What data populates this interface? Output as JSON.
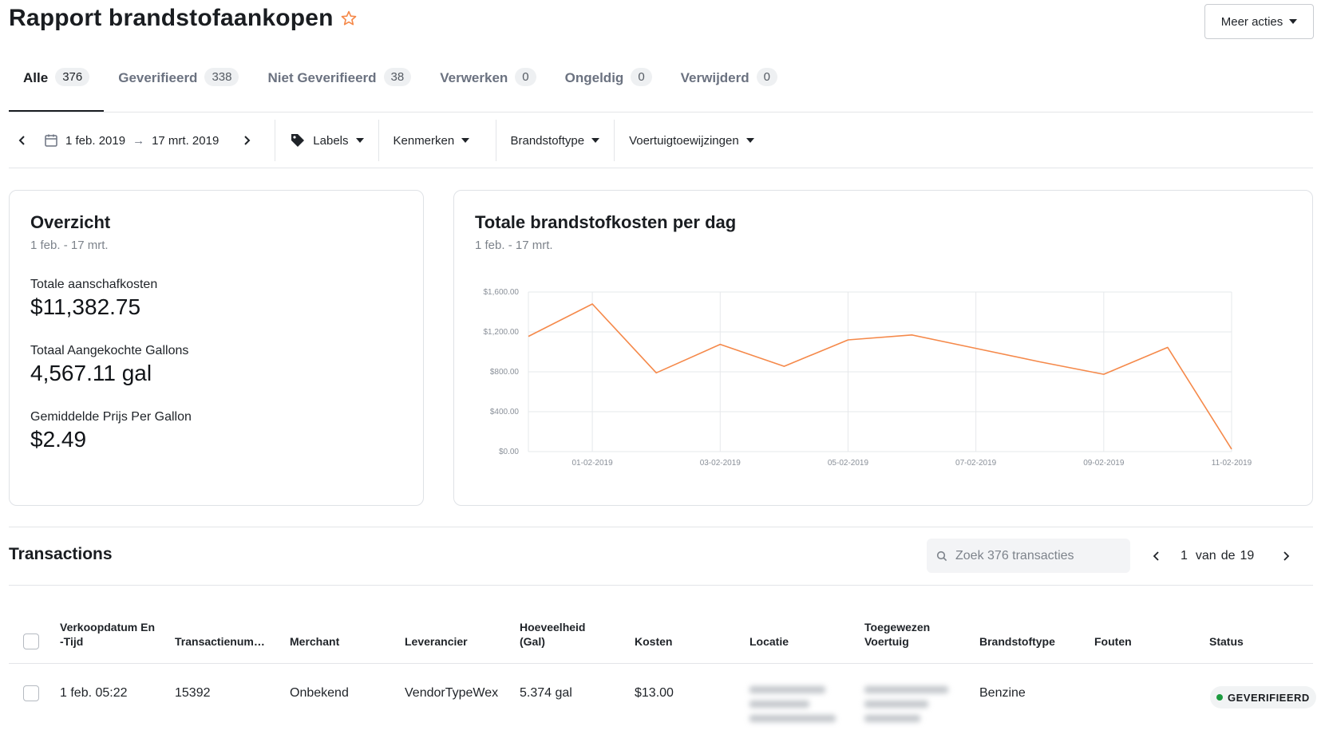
{
  "header": {
    "title": "Rapport brandstofaankopen",
    "more_actions_label": "Meer acties"
  },
  "tabs": [
    {
      "label": "Alle",
      "count": "376",
      "active": true
    },
    {
      "label": "Geverifieerd",
      "count": "338"
    },
    {
      "label": "Niet Geverifieerd",
      "count": "38"
    },
    {
      "label": "Verwerken",
      "count": "0"
    },
    {
      "label": "Ongeldig",
      "count": "0"
    },
    {
      "label": "Verwijderd",
      "count": "0"
    }
  ],
  "filters": {
    "date_from": "1 feb. 2019",
    "date_arrow": "→",
    "date_to": "17 mrt. 2019",
    "labels": "Labels",
    "features": "Kenmerken",
    "fuel_type": "Brandstoftype",
    "vehicle_assignments": "Voertuigtoewijzingen"
  },
  "overview": {
    "title": "Overzicht",
    "subtitle": "1 feb. - 17 mrt.",
    "metrics": [
      {
        "label": "Totale aanschafkosten",
        "value": "$11,382.75"
      },
      {
        "label": "Totaal Aangekochte Gallons",
        "value": "4,567.11 gal"
      },
      {
        "label": "Gemiddelde Prijs Per Gallon",
        "value": "$2.49"
      }
    ]
  },
  "chart_card": {
    "title": "Totale brandstofkosten per dag",
    "subtitle": "1 feb. - 17 mrt."
  },
  "chart_data": {
    "type": "line",
    "title": "Totale brandstofkosten per dag",
    "x": [
      "31-01-2019",
      "01-02-2019",
      "02-02-2019",
      "03-02-2019",
      "04-02-2019",
      "05-02-2019",
      "06-02-2019",
      "07-02-2019",
      "08-02-2019",
      "09-02-2019",
      "10-02-2019",
      "11-02-2019"
    ],
    "series": [
      {
        "values": [
          1155,
          1480,
          790,
          1075,
          855,
          1120,
          1170,
          1035,
          900,
          775,
          1045,
          25
        ]
      }
    ],
    "x_tick_labels": [
      "01-02-2019",
      "03-02-2019",
      "05-02-2019",
      "07-02-2019",
      "09-02-2019",
      "11-02-2019"
    ],
    "y_tick_labels": [
      "$1,600.00",
      "$1,200.00",
      "$800.00",
      "$400.00",
      "$0.00"
    ],
    "ylim": [
      0,
      1600
    ],
    "grid": true,
    "line_color": "#f5894a"
  },
  "transactions": {
    "title": "Transactions",
    "search_placeholder": "Zoek 376 transacties",
    "page_current": "1",
    "page_of_1": "van",
    "page_of_2": "de",
    "page_total": "19",
    "columns": {
      "date": "Verkoopdatum En -Tijd",
      "txn": "Transactienum…",
      "merchant": "Merchant",
      "vendor": "Leverancier",
      "quantity": "Hoeveelheid (Gal)",
      "cost": "Kosten",
      "location": "Locatie",
      "vehicle": "Toegewezen Voertuig",
      "fuel": "Brandstoftype",
      "errors": "Fouten",
      "status": "Status"
    },
    "rows": [
      {
        "date": "1 feb. 05:22",
        "txn": "15392",
        "merchant": "Onbekend",
        "vendor": "VendorTypeWex",
        "quantity": "5.374 gal",
        "cost": "$13.00",
        "fuel": "Benzine",
        "status": "GEVERIFIEERD"
      }
    ]
  },
  "colors": {
    "accent": "#f5894a",
    "verified": "#1c9b3f"
  }
}
